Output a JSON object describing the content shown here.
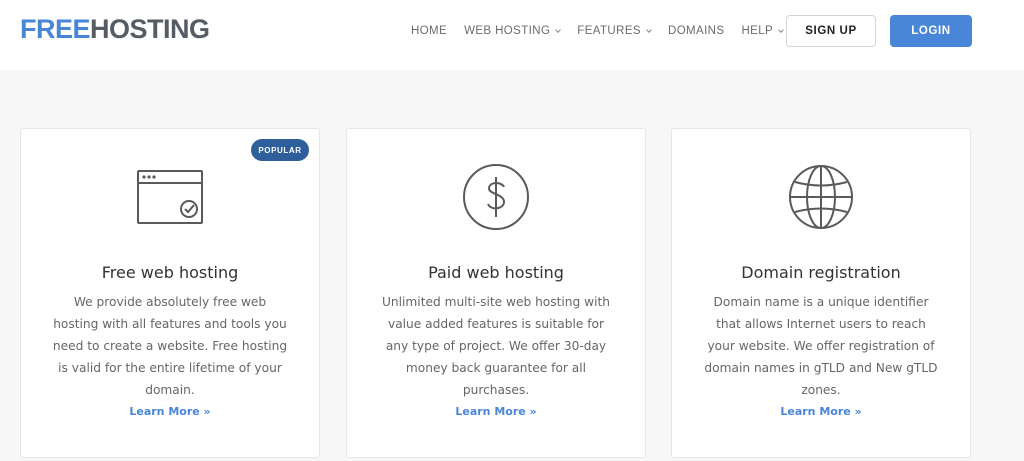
{
  "brand": {
    "part1": "FREE",
    "part2": "HOSTING"
  },
  "nav": {
    "items": [
      {
        "label": "HOME",
        "dropdown": false
      },
      {
        "label": "WEB HOSTING",
        "dropdown": true
      },
      {
        "label": "FEATURES",
        "dropdown": true
      },
      {
        "label": "DOMAINS",
        "dropdown": false
      },
      {
        "label": "HELP",
        "dropdown": true
      }
    ],
    "signup": "SIGN UP",
    "login": "LOGIN"
  },
  "colors": {
    "accent": "#4a86d8",
    "badge": "#2f5f9a",
    "icon": "#5a5a5a"
  },
  "cards": [
    {
      "icon": "browser-check-icon",
      "badge": "POPULAR",
      "title": "Free web hosting",
      "description": "We provide absolutely free web hosting with all features and tools you need to create a website. Free hosting is valid for the entire lifetime of your domain.",
      "link": "Learn More »"
    },
    {
      "icon": "dollar-circle-icon",
      "title": "Paid web hosting",
      "description": "Unlimited multi-site web hosting with value added features is suitable for any type of project. We offer 30-day money back guarantee for all purchases.",
      "link": "Learn More »"
    },
    {
      "icon": "globe-icon",
      "title": "Domain registration",
      "description": "Domain name is a unique identifier that allows Internet users to reach your website. We offer registration of domain names in gTLD and New gTLD zones.",
      "link": "Learn More »"
    }
  ]
}
